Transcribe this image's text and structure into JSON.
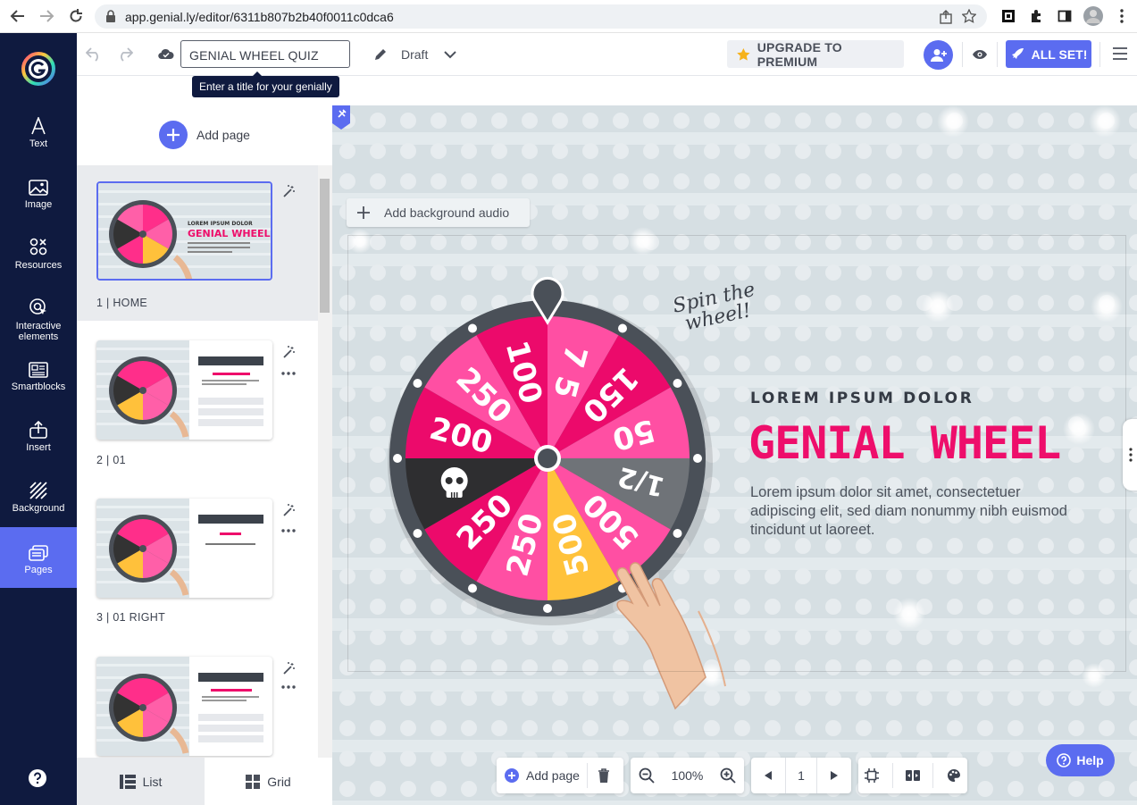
{
  "browser": {
    "url": "app.genial.ly/editor/6311b807b2b40f0011c0dca6"
  },
  "sidebar": {
    "items": [
      {
        "label": "Text",
        "icon": "text-icon"
      },
      {
        "label": "Image",
        "icon": "image-icon"
      },
      {
        "label": "Resources",
        "icon": "resources-icon"
      },
      {
        "label": "Interactive elements",
        "icon": "interactive-elements-icon"
      },
      {
        "label": "Smartblocks",
        "icon": "smartblocks-icon"
      },
      {
        "label": "Insert",
        "icon": "insert-icon"
      },
      {
        "label": "Background",
        "icon": "background-icon"
      },
      {
        "label": "Pages",
        "icon": "pages-icon"
      }
    ],
    "help_icon": "help-circle-icon"
  },
  "toolbar": {
    "title_value": "GENIAL WHEEL QUIZ",
    "tooltip": "Enter a title for your genially",
    "status": "Draft",
    "upgrade_label": "UPGRADE TO PREMIUM",
    "publish_label": "ALL SET!"
  },
  "pages_panel": {
    "add_page_label": "Add page",
    "pages": [
      {
        "number": "1",
        "label": "1 |  HOME"
      },
      {
        "number": "2",
        "label": "2 |  01"
      },
      {
        "number": "3",
        "label": "3 |  01 RIGHT"
      },
      {
        "number": "4",
        "label": ""
      }
    ],
    "view_tabs": {
      "list": "List",
      "grid": "Grid"
    }
  },
  "canvas": {
    "bg_audio_label": "Add background audio",
    "spin_line1": "Spin the",
    "spin_line2": "wheel!",
    "subtitle": "LOREM IPSUM DOLOR",
    "title": "GENIAL WHEEL",
    "body": "Lorem ipsum dolor sit amet, consectetuer adipiscing elit, sed diam nonummy nibh euismod tincidunt ut laoreet.",
    "wheel_segments": [
      "7",
      "150",
      "50",
      "1/2",
      "500",
      "500",
      "250",
      "skull",
      "200",
      "250",
      "100",
      "75"
    ]
  },
  "bottom_bar": {
    "add_page_label": "Add page",
    "zoom": "100%",
    "page_number": "1"
  },
  "help_label": "Help",
  "colors": {
    "nav_bg": "#0f1a3f",
    "accent": "#5b6cf0",
    "brand_pink": "#ee0e6b"
  }
}
